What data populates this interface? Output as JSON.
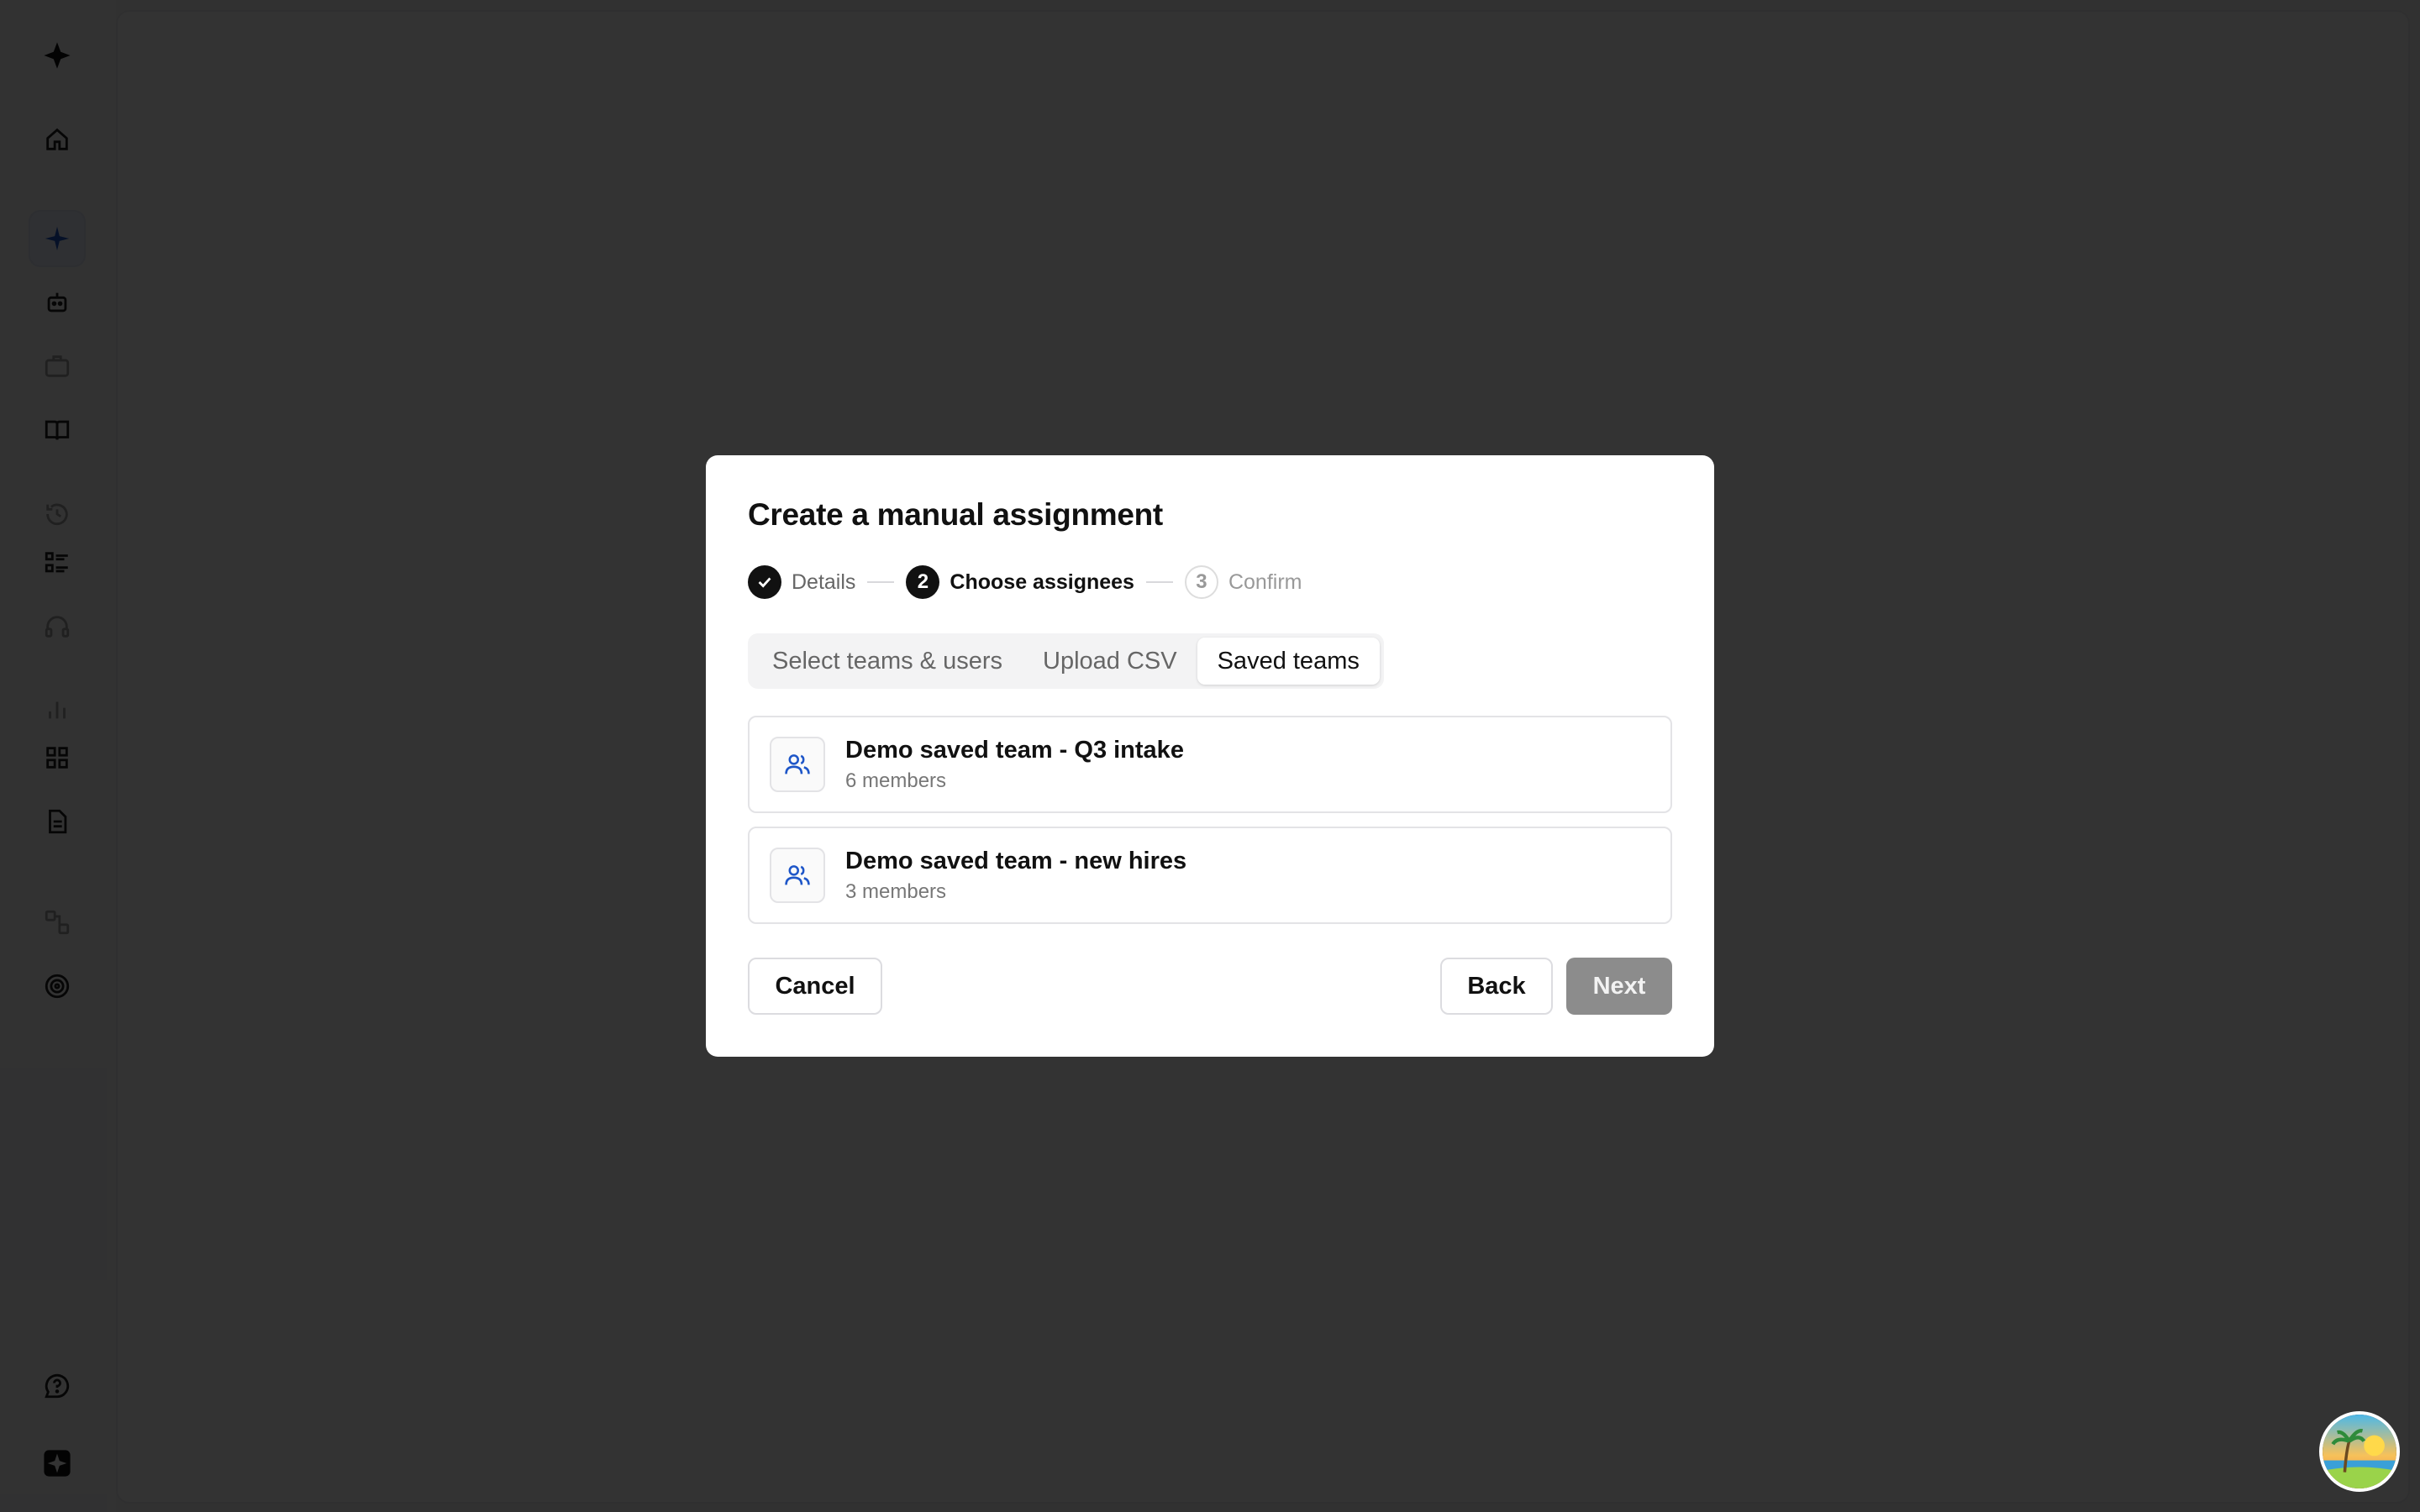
{
  "modal": {
    "title": "Create a manual assignment",
    "steps": [
      {
        "number": "1",
        "label": "Details",
        "status": "done"
      },
      {
        "number": "2",
        "label": "Choose assignees",
        "status": "current"
      },
      {
        "number": "3",
        "label": "Confirm",
        "status": "todo"
      }
    ],
    "tabs": [
      {
        "label": "Select teams & users",
        "active": false
      },
      {
        "label": "Upload CSV",
        "active": false
      },
      {
        "label": "Saved teams",
        "active": true
      }
    ],
    "teams": [
      {
        "name": "Demo saved team - Q3 intake",
        "members": "6 members"
      },
      {
        "name": "Demo saved team - new hires",
        "members": "3 members"
      }
    ],
    "buttons": {
      "cancel": "Cancel",
      "back": "Back",
      "next": "Next"
    }
  },
  "sidebar": {
    "icons": [
      "logo-icon",
      "home-icon",
      "sparkle-icon",
      "bot-icon",
      "briefcase-icon",
      "book-icon",
      "history-icon",
      "checklist-icon",
      "headset-icon",
      "bar-chart-icon",
      "grid-icon",
      "document-icon",
      "workflow-icon",
      "target-icon",
      "help-icon",
      "workspace-icon"
    ]
  },
  "colors": {
    "accent": "#1e56c8",
    "overlay": "rgba(0,0,0,0.8)",
    "disabled_button": "#8c8c8c"
  }
}
